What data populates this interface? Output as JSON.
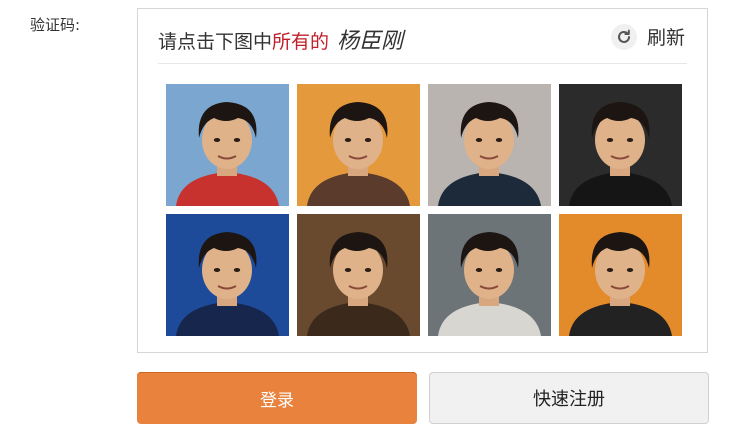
{
  "form": {
    "captcha_label": "验证码:"
  },
  "captcha": {
    "prompt_prefix": "请点击下图中",
    "prompt_emphasis": "所有的",
    "prompt_target": "杨臣刚",
    "refresh_label": "刷新",
    "refresh_icon": "refresh-icon",
    "tiles": [
      {
        "background": "#7aa6cf",
        "shirt": "#c8322e"
      },
      {
        "background": "#e49a3c",
        "shirt": "#5a3b2c"
      },
      {
        "background": "#b9b4b0",
        "shirt": "#1d2a3a"
      },
      {
        "background": "#2b2b2b",
        "shirt": "#151515"
      },
      {
        "background": "#1d4b9a",
        "shirt": "#16264d"
      },
      {
        "background": "#6a4a2e",
        "shirt": "#3b2a1c"
      },
      {
        "background": "#6c7477",
        "shirt": "#d8d6d0"
      },
      {
        "background": "#e38b2a",
        "shirt": "#222222"
      }
    ]
  },
  "actions": {
    "login_label": "登录",
    "register_label": "快速注册"
  },
  "colors": {
    "accent": "#e8823d",
    "emphasis": "#c0202a"
  }
}
